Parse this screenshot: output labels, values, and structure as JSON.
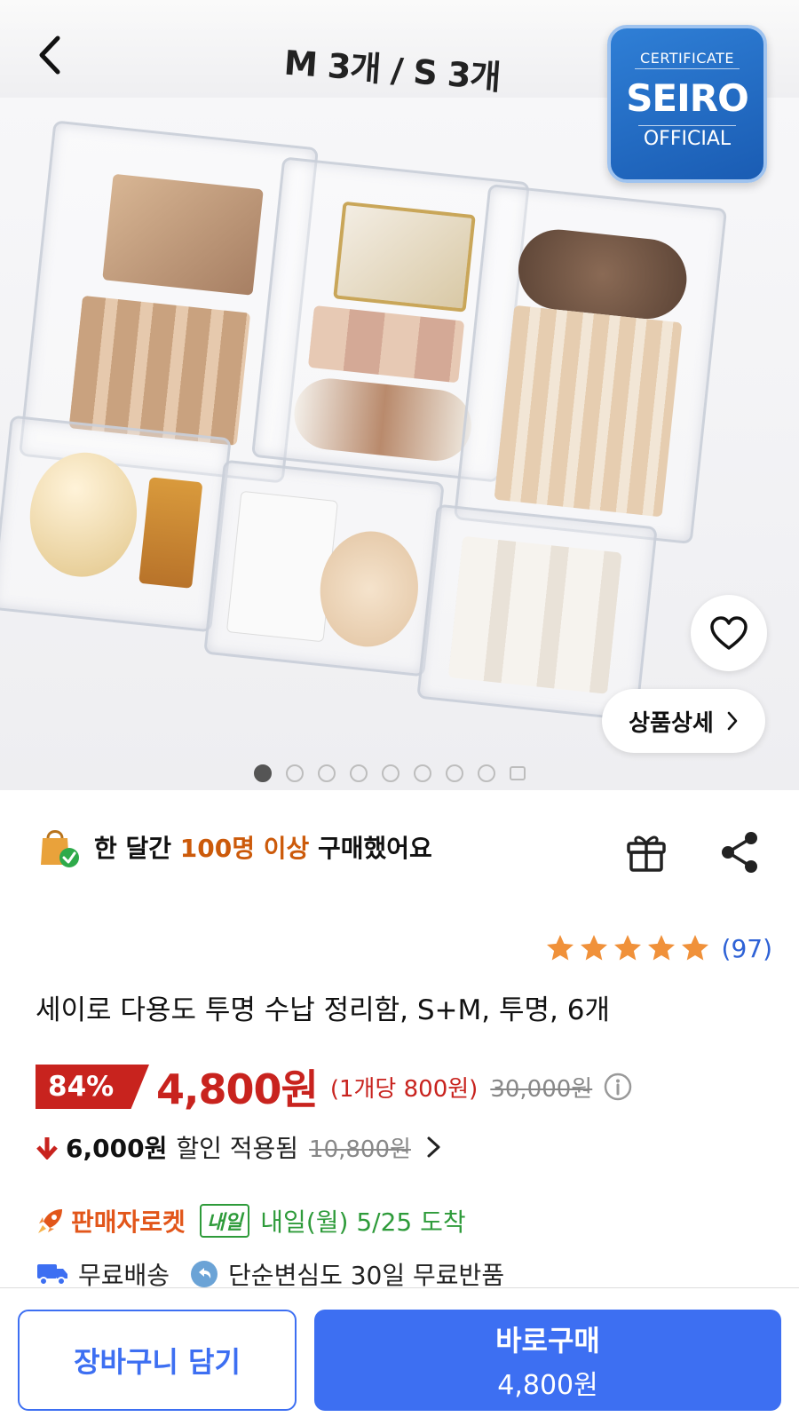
{
  "hero": {
    "caption": "M 3개 / S 3개",
    "certificate": {
      "line1": "CERTIFICATE",
      "brand": "SEIRO",
      "line3": "OFFICIAL"
    },
    "detail_button_label": "상품상세",
    "carousel": {
      "total_dots": 8,
      "active_index": 0
    }
  },
  "social": {
    "prefix": "한 달간 ",
    "highlight": "100명 이상",
    "suffix": " 구매했어요"
  },
  "rating": {
    "stars": 5,
    "review_count": "(97)"
  },
  "product": {
    "title": "세이로 다용도 투명 수납 정리함, S+M, 투명, 6개"
  },
  "price": {
    "discount": "84%",
    "sale_price": "4,800원",
    "unit_price": "(1개당 800원)",
    "original_price": "30,000원"
  },
  "coupon": {
    "amount": "6,000원",
    "text": "할인 적용됨",
    "old_price": "10,800원"
  },
  "delivery": {
    "seller_rocket": "판매자로켓",
    "tomorrow_badge": "내일",
    "arrival": "내일(월) 5/25 도착"
  },
  "shipping": {
    "free_shipping": "무료배송",
    "free_return": "단순변심도 30일 무료반품"
  },
  "bottom_bar": {
    "cart_label": "장바구니 담기",
    "buy_label": "바로구매",
    "buy_price": "4,800원"
  },
  "colors": {
    "accent_blue": "#3d6ff2",
    "sale_red": "#c8231e",
    "rocket_orange": "#e2561a",
    "delivery_green": "#2e9b3a",
    "star_orange": "#f0913a"
  }
}
